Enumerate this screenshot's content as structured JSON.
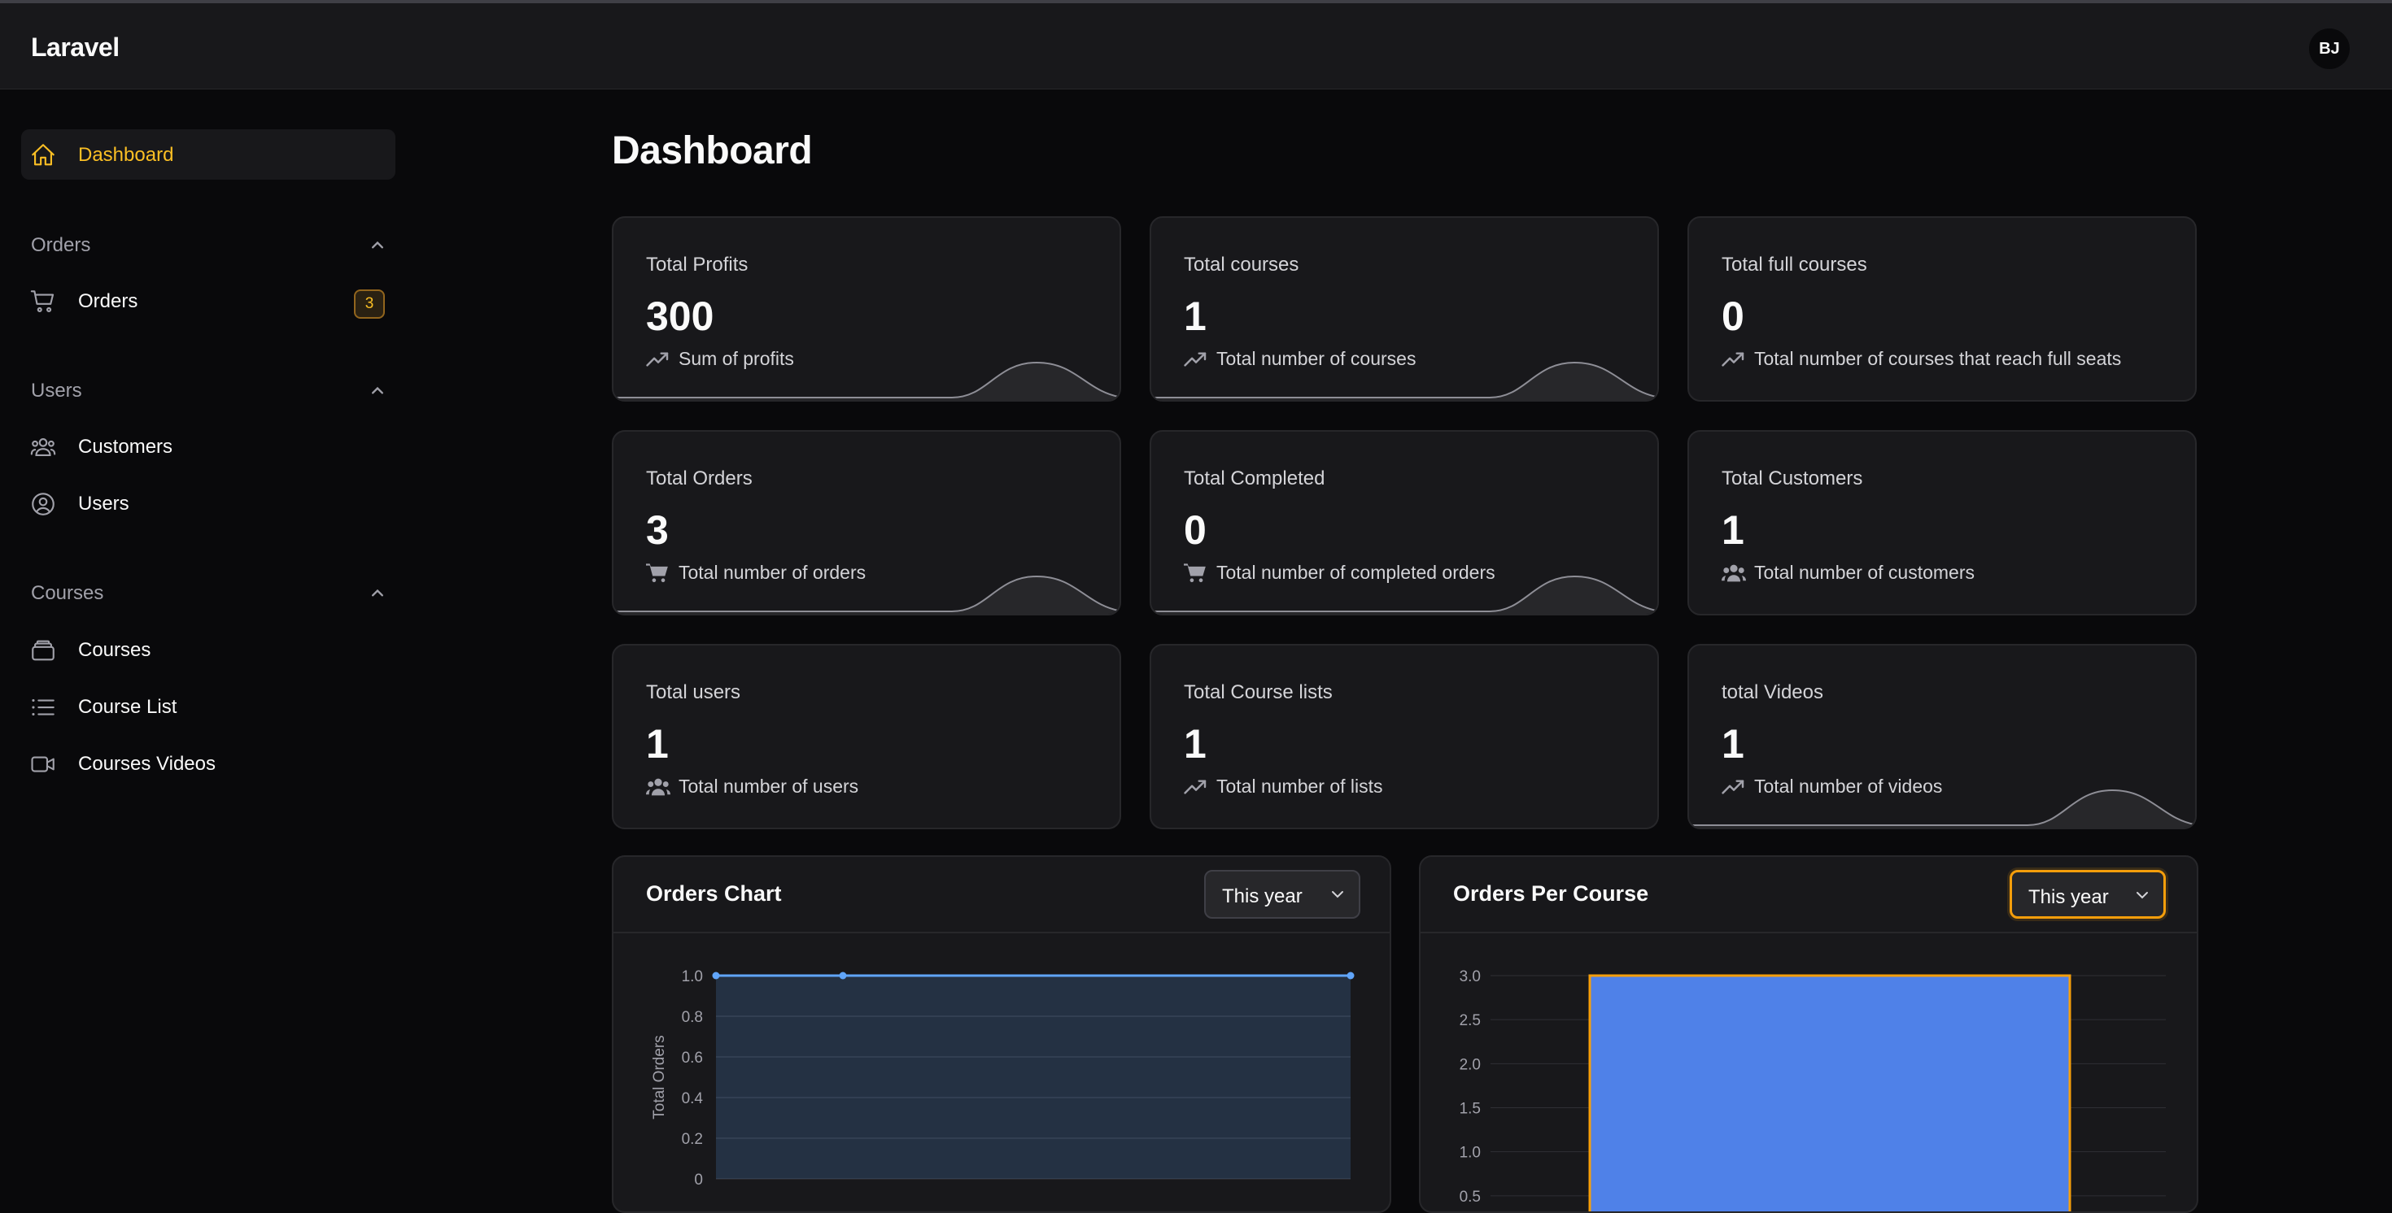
{
  "app": {
    "brand": "Laravel",
    "user_initials": "BJ"
  },
  "sidebar": {
    "dashboard": {
      "label": "Dashboard",
      "icon": "home-icon"
    },
    "groups": [
      {
        "label": "Orders",
        "items": [
          {
            "label": "Orders",
            "icon": "cart-icon",
            "badge": "3"
          }
        ]
      },
      {
        "label": "Users",
        "items": [
          {
            "label": "Customers",
            "icon": "user-group-icon"
          },
          {
            "label": "Users",
            "icon": "user-circle-icon"
          }
        ]
      },
      {
        "label": "Courses",
        "items": [
          {
            "label": "Courses",
            "icon": "stack-icon"
          },
          {
            "label": "Course List",
            "icon": "list-icon"
          },
          {
            "label": "Courses Videos",
            "icon": "video-camera-icon"
          }
        ]
      }
    ]
  },
  "page": {
    "title": "Dashboard"
  },
  "stats": [
    {
      "title": "Total Profits",
      "value": "300",
      "desc": "Sum of profits",
      "icon": "trending-up-icon"
    },
    {
      "title": "Total courses",
      "value": "1",
      "desc": "Total number of courses",
      "icon": "trending-up-icon"
    },
    {
      "title": "Total full courses",
      "value": "0",
      "desc": "Total number of courses that reach full seats",
      "icon": "trending-up-icon"
    },
    {
      "title": "Total Orders",
      "value": "3",
      "desc": "Total number of orders",
      "icon": "shopping-cart-icon"
    },
    {
      "title": "Total Completed",
      "value": "0",
      "desc": "Total number of completed orders",
      "icon": "shopping-cart-icon"
    },
    {
      "title": "Total Customers",
      "value": "1",
      "desc": "Total number of customers",
      "icon": "user-group-icon"
    },
    {
      "title": "Total users",
      "value": "1",
      "desc": "Total number of users",
      "icon": "user-group-icon"
    },
    {
      "title": "Total Course lists",
      "value": "1",
      "desc": "Total number of lists",
      "icon": "trending-up-icon"
    },
    {
      "title": "total Videos",
      "value": "1",
      "desc": "Total number of videos",
      "icon": "trending-up-icon"
    }
  ],
  "orders_chart": {
    "title": "Orders Chart",
    "filter": "This year"
  },
  "orders_per_course": {
    "title": "Orders Per Course",
    "filter": "This year"
  },
  "colors": {
    "accent": "#fbbf24",
    "line": "#60a5fa",
    "bar": "#4f81e8",
    "bar_border": "#f59e0b"
  },
  "chart_data": [
    {
      "type": "area",
      "title": "Orders Chart",
      "ylabel": "Total Orders",
      "ylim": [
        0,
        1
      ],
      "yticks": [
        "1.0",
        "0.8",
        "0.6",
        "0.4",
        "0.2",
        "0"
      ],
      "series": [
        {
          "values": [
            1,
            1,
            1
          ]
        }
      ],
      "grid": true
    },
    {
      "type": "bar",
      "title": "Orders Per Course",
      "ylim": [
        0,
        3
      ],
      "yticks": [
        "3.0",
        "2.5",
        "2.0",
        "1.5",
        "1.0",
        "0.5"
      ],
      "values": [
        3
      ],
      "grid": true
    }
  ]
}
